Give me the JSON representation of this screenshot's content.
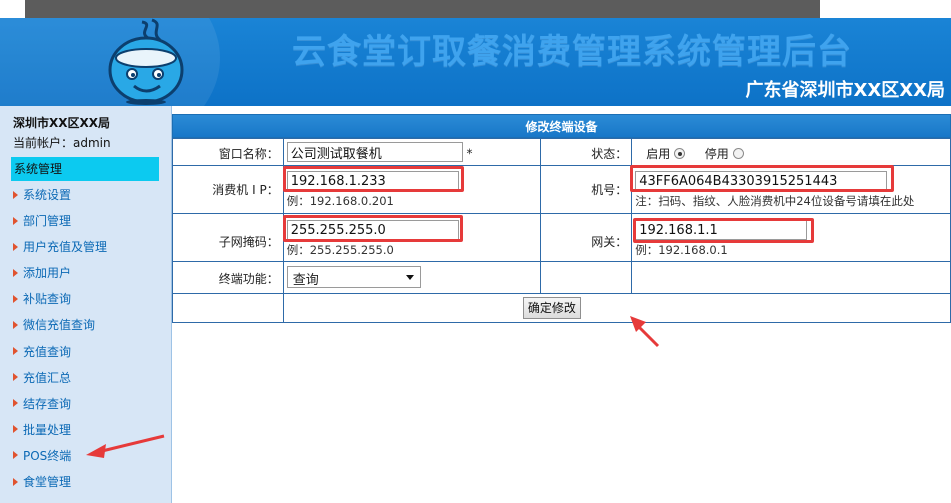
{
  "header": {
    "system_title": "云食堂订取餐消费管理系统管理后台",
    "org_name": "广东省深圳市XX区XX局"
  },
  "sidebar": {
    "org": "深圳市XX区XX局",
    "account_label": "当前帐户：admin",
    "section": "系统管理",
    "items": [
      {
        "label": "系统设置"
      },
      {
        "label": "部门管理"
      },
      {
        "label": "用户充值及管理"
      },
      {
        "label": "添加用户"
      },
      {
        "label": "补贴查询"
      },
      {
        "label": "微信充值查询"
      },
      {
        "label": "充值查询"
      },
      {
        "label": "充值汇总"
      },
      {
        "label": "结存查询"
      },
      {
        "label": "批量处理"
      },
      {
        "label": "POS终端"
      },
      {
        "label": "食堂管理"
      }
    ]
  },
  "form": {
    "title": "修改终端设备",
    "window_label": "窗口名称：",
    "window_value": "公司测试取餐机",
    "required_mark": "*",
    "status_label": "状态：",
    "status_enabled": "启用",
    "status_disabled": "停用",
    "ip_label": "消费机 I P：",
    "ip_value": "192.168.1.233",
    "ip_hint": "例：192.168.0.201",
    "machine_label": "机号：",
    "machine_value": "43FF6A064B43303915251443",
    "machine_hint": "注：扫码、指纹、人脸消费机中24位设备号请填在此处",
    "mask_label": "子网掩码：",
    "mask_value": "255.255.255.0",
    "mask_hint": "例：255.255.255.0",
    "gateway_label": "网关：",
    "gateway_value": "192.168.1.1",
    "gateway_hint": "例：192.168.0.1",
    "function_label": "终端功能：",
    "function_value": "查询",
    "submit_label": "确定修改"
  },
  "colors": {
    "annotation_red": "#e63a3a",
    "banner_blue": "#0d72c7",
    "menu_active": "#0ccaf0"
  }
}
